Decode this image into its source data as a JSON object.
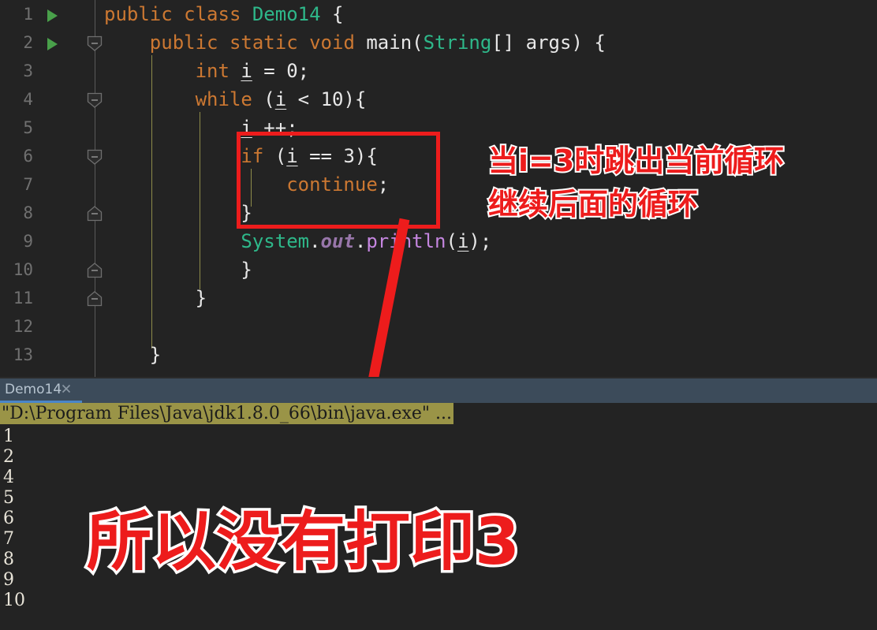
{
  "editor": {
    "line_numbers": [
      "1",
      "2",
      "3",
      "4",
      "5",
      "6",
      "7",
      "8",
      "9",
      "10",
      "11",
      "12",
      "13"
    ],
    "run_marker_lines": [
      1,
      2
    ],
    "fold_markers": [
      {
        "line": 2,
        "type": "expanded-down"
      },
      {
        "line": 4,
        "type": "expanded-down"
      },
      {
        "line": 6,
        "type": "expanded-down"
      },
      {
        "line": 8,
        "type": "end-up"
      },
      {
        "line": 10,
        "type": "end-up"
      },
      {
        "line": 11,
        "type": "end-up"
      }
    ],
    "lines": [
      {
        "n": "1",
        "tokens": [
          {
            "t": "public ",
            "c": "kw"
          },
          {
            "t": "class ",
            "c": "kw"
          },
          {
            "t": "Demo14",
            "c": "cls"
          },
          {
            "t": " {",
            "c": "pln"
          }
        ]
      },
      {
        "n": "2",
        "tokens": [
          {
            "t": "    ",
            "c": "pln"
          },
          {
            "t": "public ",
            "c": "kw"
          },
          {
            "t": "static ",
            "c": "kw"
          },
          {
            "t": "void ",
            "c": "kw"
          },
          {
            "t": "main",
            "c": "pln"
          },
          {
            "t": "(",
            "c": "pln"
          },
          {
            "t": "String",
            "c": "cls"
          },
          {
            "t": "[] args) {",
            "c": "pln"
          }
        ]
      },
      {
        "n": "3",
        "tokens": [
          {
            "t": "        ",
            "c": "pln"
          },
          {
            "t": "int ",
            "c": "kw"
          },
          {
            "t": "i",
            "c": "var"
          },
          {
            "t": " = ",
            "c": "pln"
          },
          {
            "t": "0",
            "c": "num"
          },
          {
            "t": ";",
            "c": "pln"
          }
        ]
      },
      {
        "n": "4",
        "tokens": [
          {
            "t": "        ",
            "c": "pln"
          },
          {
            "t": "while ",
            "c": "kw"
          },
          {
            "t": "(",
            "c": "pln"
          },
          {
            "t": "i",
            "c": "var"
          },
          {
            "t": " < ",
            "c": "pln"
          },
          {
            "t": "10",
            "c": "num"
          },
          {
            "t": "){",
            "c": "pln"
          }
        ]
      },
      {
        "n": "5",
        "tokens": [
          {
            "t": "            ",
            "c": "pln"
          },
          {
            "t": "i",
            "c": "var"
          },
          {
            "t": " ++;",
            "c": "pln"
          }
        ]
      },
      {
        "n": "6",
        "tokens": [
          {
            "t": "            ",
            "c": "pln"
          },
          {
            "t": "if ",
            "c": "kw"
          },
          {
            "t": "(",
            "c": "pln"
          },
          {
            "t": "i",
            "c": "var"
          },
          {
            "t": " == ",
            "c": "pln"
          },
          {
            "t": "3",
            "c": "num"
          },
          {
            "t": "){",
            "c": "pln"
          }
        ]
      },
      {
        "n": "7",
        "tokens": [
          {
            "t": "                ",
            "c": "pln"
          },
          {
            "t": "continue",
            "c": "kw"
          },
          {
            "t": ";",
            "c": "pln"
          }
        ]
      },
      {
        "n": "8",
        "tokens": [
          {
            "t": "            }",
            "c": "pln"
          }
        ]
      },
      {
        "n": "9",
        "tokens": [
          {
            "t": "            ",
            "c": "pln"
          },
          {
            "t": "System",
            "c": "cls"
          },
          {
            "t": ".",
            "c": "pln"
          },
          {
            "t": "out",
            "c": "fld"
          },
          {
            "t": ".",
            "c": "pln"
          },
          {
            "t": "println",
            "c": "mth"
          },
          {
            "t": "(",
            "c": "pln"
          },
          {
            "t": "i",
            "c": "var"
          },
          {
            "t": ");",
            "c": "pln"
          }
        ]
      },
      {
        "n": "10",
        "tokens": [
          {
            "t": "            }",
            "c": "pln"
          }
        ]
      },
      {
        "n": "11",
        "tokens": [
          {
            "t": "        }",
            "c": "pln"
          }
        ]
      },
      {
        "n": "12",
        "tokens": [
          {
            "t": "",
            "c": "pln"
          }
        ]
      },
      {
        "n": "13",
        "tokens": [
          {
            "t": "    }",
            "c": "pln"
          }
        ]
      }
    ]
  },
  "annotations": {
    "note_line_1": "当i=3时跳出当前循环",
    "note_line_2": "继续后面的循环",
    "big_note": "所以没有打印3",
    "highlight_color": "#ed1c1c",
    "outline_color": "#ffffff",
    "box_target_code": "if (i == 3){ continue; }"
  },
  "toolwindow": {
    "tab_label": "Demo14",
    "tab_close_icon": "close-icon",
    "tab_accent_color": "#4a86c8"
  },
  "console": {
    "command_line": "\"D:\\Program Files\\Java\\jdk1.8.0_66\\bin\\java.exe\" ...",
    "command_line_bg": "#9a9447",
    "output": [
      "1",
      "2",
      "4",
      "5",
      "6",
      "7",
      "8",
      "9",
      "10"
    ]
  },
  "theme": {
    "editor_bg": "#232323",
    "gutter_text": "#707070",
    "keyword": "#cc7832",
    "class_name": "#2eb88a",
    "plain_text": "#e8e8e8",
    "field": "#9876aa",
    "method": "#c586e0",
    "indent_guide": "#8e8b4a",
    "run_marker": "#49a04a",
    "tabbar_bg": "#3c4b5a"
  }
}
